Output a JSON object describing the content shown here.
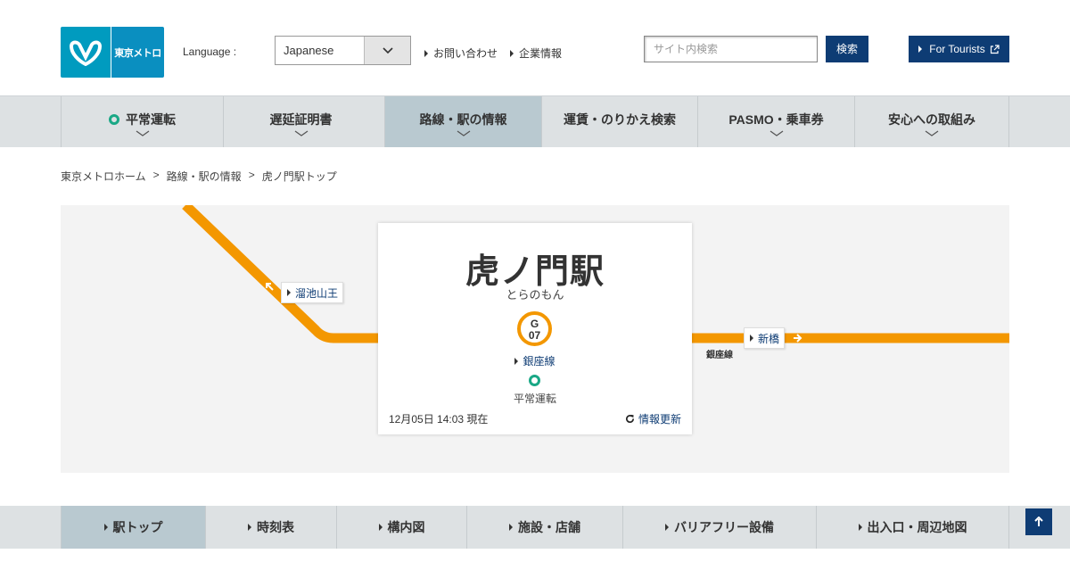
{
  "header": {
    "logo_text": "東京メトロ",
    "language_label": "Language :",
    "language_selected": "Japanese",
    "links": [
      "お問い合わせ",
      "企業情報"
    ],
    "search_placeholder": "サイト内検索",
    "search_button": "検索",
    "tourists_button": "For Tourists"
  },
  "global_nav": [
    {
      "label": "平常運転",
      "status": "normal"
    },
    {
      "label": "遅延証明書"
    },
    {
      "label": "路線・駅の情報",
      "active": true
    },
    {
      "label": "運賃・のりかえ検索"
    },
    {
      "label": "PASMO・乗車券"
    },
    {
      "label": "安心への取組み"
    }
  ],
  "breadcrumb": [
    "東京メトロホーム",
    "路線・駅の情報",
    "虎ノ門駅トップ"
  ],
  "breadcrumb_separator": ">",
  "map": {
    "prev_station": "溜池山王",
    "next_station": "新橋",
    "line_caption": "銀座線",
    "line_color": "#f39700"
  },
  "station": {
    "name": "虎ノ門駅",
    "kana": "とらのもん",
    "code_letter": "G",
    "code_number": "07",
    "line_link": "銀座線",
    "operation_status": "平常運転",
    "as_of": "12月05日 14:03 現在",
    "refresh_label": "情報更新"
  },
  "local_nav": [
    {
      "label": "駅トップ",
      "active": true
    },
    {
      "label": "時刻表"
    },
    {
      "label": "構内図"
    },
    {
      "label": "施設・店舗"
    },
    {
      "label": "バリアフリー設備"
    },
    {
      "label": "出入口・周辺地図"
    }
  ],
  "colors": {
    "brand_blue": "#009bbf",
    "navy": "#0e3c74",
    "ginza_orange": "#f39700",
    "status_green": "#1aa886"
  }
}
